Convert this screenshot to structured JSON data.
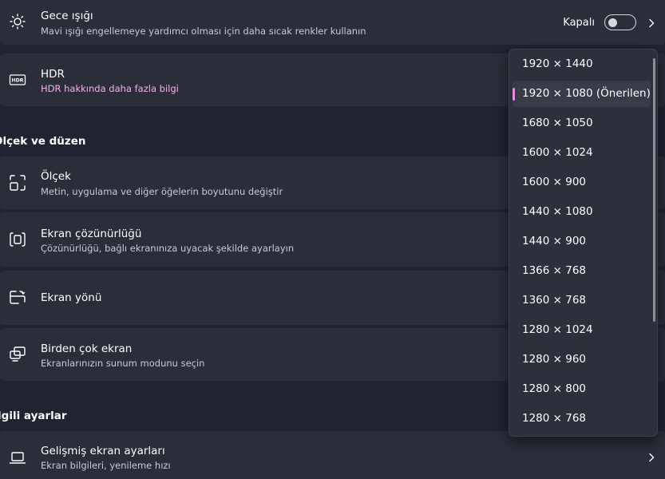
{
  "colors": {
    "page_bg": "#202330",
    "card_bg": "#2b2d39",
    "link": "#f0b3ee",
    "accent": "#e58ee3",
    "dropdown_bg": "#2d2f3b"
  },
  "night_light": {
    "icon": "brightness-icon",
    "title": "Gece ışığı",
    "description": "Mavi ışığı engellemeye yardımcı olması için daha sıcak renkler kullanın",
    "toggle_label": "Kapalı",
    "toggle_on": false
  },
  "hdr": {
    "icon": "hdr-icon",
    "title": "HDR",
    "link": "HDR hakkında daha fazla bilgi"
  },
  "sections": {
    "scale_layout": "Ölçek ve düzen",
    "related": "İlgili ayarlar"
  },
  "scale": {
    "icon": "scale-icon",
    "title": "Ölçek",
    "description": "Metin, uygulama ve diğer öğelerin boyutunu değiştir"
  },
  "resolution": {
    "icon": "resolution-icon",
    "title": "Ekran çözünürlüğü",
    "description": "Çözünürlüğü, bağlı ekranınıza uyacak şekilde ayarlayın"
  },
  "orientation": {
    "icon": "orientation-icon",
    "title": "Ekran yönü"
  },
  "multiple": {
    "icon": "multiple-displays-icon",
    "title": "Birden çok ekran",
    "description": "Ekranlarınızın sunum modunu seçin"
  },
  "advanced": {
    "icon": "laptop-icon",
    "title": "Gelişmiş ekran ayarları",
    "description": "Ekran bilgileri, yenileme hızı"
  },
  "resolution_dropdown": {
    "selected_index": 1,
    "options": [
      "1920 × 1440",
      "1920 × 1080 (Önerilen)",
      "1680 × 1050",
      "1600 × 1024",
      "1600 × 900",
      "1440 × 1080",
      "1440 × 900",
      "1366 × 768",
      "1360 × 768",
      "1280 × 1024",
      "1280 × 960",
      "1280 × 800",
      "1280 × 768"
    ]
  }
}
